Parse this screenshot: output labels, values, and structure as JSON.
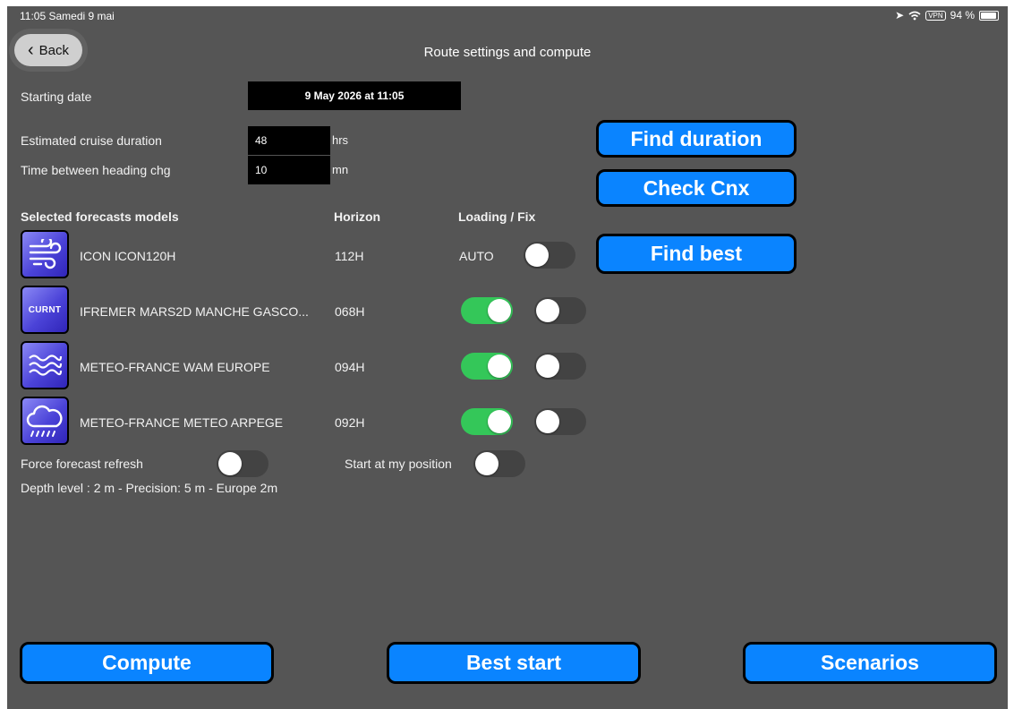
{
  "status_bar": {
    "time_date": "11:05  Samedi 9 mai",
    "vpn": "VPN",
    "battery": "94 %"
  },
  "nav": {
    "back_label": "Back",
    "title": "Route settings and compute"
  },
  "settings": {
    "starting_date_label": "Starting date",
    "starting_date_value": "9 May 2026 at 11:05",
    "duration_label": "Estimated cruise duration",
    "duration_value": "48",
    "duration_unit": "hrs",
    "heading_label": "Time between heading chg",
    "heading_value": "10",
    "heading_unit": "mn"
  },
  "side_buttons": {
    "find_duration": "Find duration",
    "check_cnx": "Check Cnx",
    "find_best": "Find best"
  },
  "forecasts": {
    "header_models": "Selected forecasts models",
    "header_horizon": "Horizon",
    "header_loading": "Loading / Fix",
    "rows": [
      {
        "name": "ICON ICON120H",
        "horizon": "112H",
        "loading": "AUTO",
        "icon": "wind-icon",
        "load_on": null,
        "fix_on": false
      },
      {
        "name": "IFREMER MARS2D MANCHE GASCO...",
        "horizon": "068H",
        "loading": "",
        "icon": "current-icon",
        "icon_text": "CURNT",
        "load_on": true,
        "fix_on": false
      },
      {
        "name": "METEO-FRANCE WAM EUROPE",
        "horizon": "094H",
        "loading": "",
        "icon": "waves-icon",
        "load_on": true,
        "fix_on": false
      },
      {
        "name": "METEO-FRANCE METEO ARPEGE",
        "horizon": "092H",
        "loading": "",
        "icon": "cloud-rain-icon",
        "load_on": true,
        "fix_on": false
      }
    ]
  },
  "options": {
    "force_refresh_label": "Force forecast refresh",
    "force_refresh_on": false,
    "start_position_label": "Start at my position",
    "start_position_on": false,
    "depth_info": "Depth level : 2 m - Precision: 5 m - Europe 2m"
  },
  "bottom_buttons": {
    "compute": "Compute",
    "best_start": "Best start",
    "scenarios": "Scenarios"
  },
  "colors": {
    "background": "#555555",
    "button_blue": "#0a84ff",
    "toggle_on": "#34c759",
    "icon_blue": "#4b43d8"
  }
}
